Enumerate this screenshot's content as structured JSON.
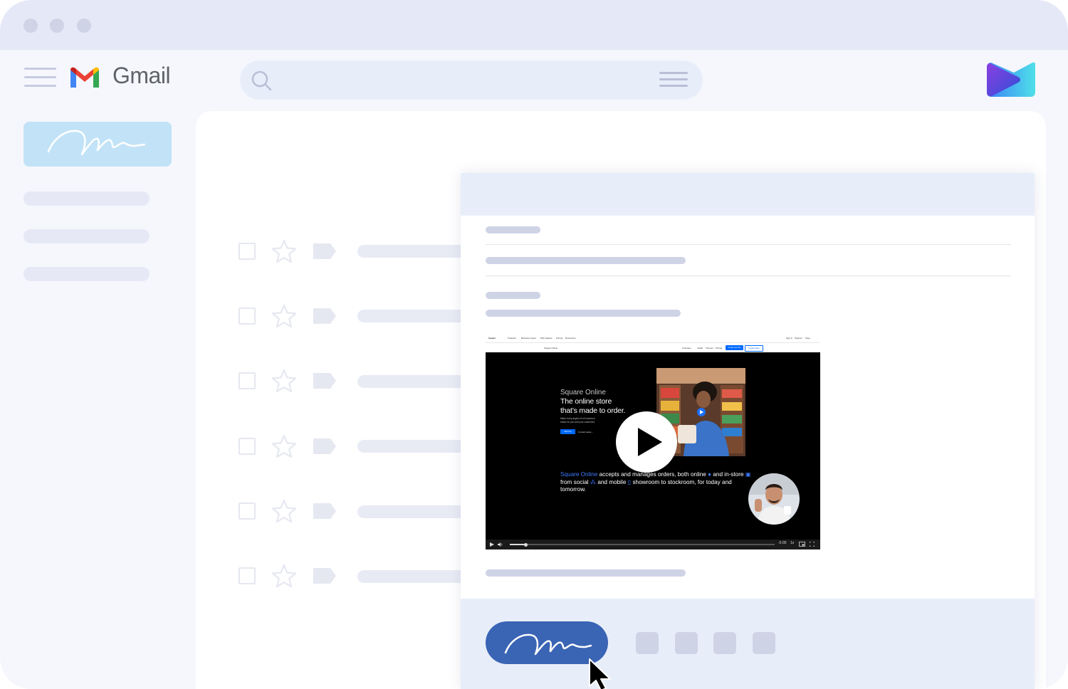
{
  "app": {
    "name": "Gmail",
    "brand_colors": {
      "gmail_red": "#ea4335",
      "gmail_blue": "#4285f4",
      "gmail_green": "#34a853",
      "gmail_yellow": "#fbbc04",
      "accent": "#3a64b4"
    }
  },
  "window": {
    "controls": [
      "window-dot-close",
      "window-dot-minimize",
      "window-dot-maximize"
    ]
  },
  "header": {
    "menu_icon": "hamburger-menu-icon",
    "logo_icon": "gmail-m-logo-icon",
    "title": "Gmail",
    "search_icon": "search-icon",
    "search_options_icon": "search-options-icon",
    "brand_icon": "video-brand-logo-icon"
  },
  "sidebar": {
    "compose_icon": "signature-icon",
    "items": [
      "placeholder",
      "placeholder",
      "placeholder"
    ]
  },
  "inbox": {
    "rows": 6,
    "row_icons": [
      "checkbox-icon",
      "star-icon",
      "label-icon"
    ]
  },
  "email": {
    "video": {
      "nav_brand": "Square",
      "nav_items": [
        "Products",
        "Business Types",
        "Why Square",
        "Pricing",
        "Resources"
      ],
      "nav_right": [
        "Sign in",
        "Support",
        "Shop"
      ],
      "subnav_title": "Square Online",
      "subnav_items": [
        "Overview",
        "Install",
        "Themes",
        "Pricing"
      ],
      "subnav_buttons": [
        "Create your site",
        "Contact sales"
      ],
      "brand": "Square Online",
      "headline_line1": "The online store",
      "headline_line2": "that’s made to order.",
      "body_line1": "Make every aspect of eCommerce",
      "body_line2": "easier for you and your customers.",
      "cta_primary": "Start free",
      "cta_secondary": "Contact sales ›",
      "desc_highlight": "Square Online",
      "desc_part1": " accepts and manages orders, both online ",
      "desc_part2": " and in-store ",
      "desc_part3": " from social ",
      "desc_part4": " and mobile ",
      "desc_part5": " showroom to stockroom, for today and tomorrow.",
      "time_remaining": "-5:00",
      "speed": "1x",
      "progress": 0.06,
      "play_icon": "play-icon"
    },
    "footer": {
      "sign_icon": "signature-icon",
      "cursor_icon": "mouse-pointer-icon",
      "tool_count": 4
    }
  }
}
